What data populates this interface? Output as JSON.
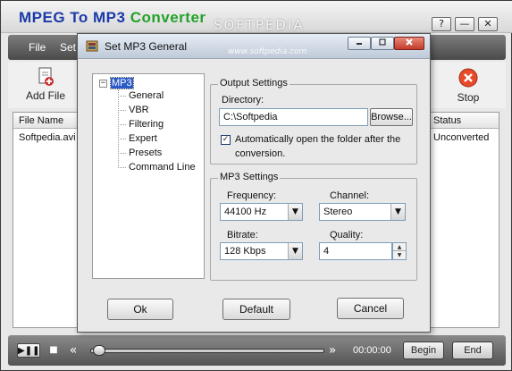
{
  "app": {
    "title_part1": "MPEG To MP3",
    "title_part2": "Converter",
    "watermark": "SOFTPEDIA",
    "help_glyph": "?",
    "minimize_glyph": "—",
    "close_glyph": "✕"
  },
  "menu": {
    "items": [
      "File",
      "Set"
    ]
  },
  "toolbar": {
    "add_file_label": "Add File",
    "stop_label": "Stop"
  },
  "file_list": {
    "columns": [
      "File Name",
      "Status"
    ],
    "rows": [
      {
        "file_name": "Softpedia.avi",
        "status": "Unconverted"
      }
    ]
  },
  "player": {
    "play_pause_glyph": "▶❚❚",
    "stop_glyph": "■",
    "rewind_glyph": "«",
    "forward_glyph": "»",
    "time": "00:00:00",
    "begin_label": "Begin",
    "end_label": "End",
    "seek_position": 0
  },
  "dialog": {
    "title": "Set MP3 General",
    "watermark": "www.softpedia.com",
    "tree": {
      "toggle": "−",
      "root": "MP3",
      "children": [
        "General",
        "VBR",
        "Filtering",
        "Expert",
        "Presets",
        "Command Line"
      ]
    },
    "output_settings": {
      "group_label": "Output Settings",
      "directory_label": "Directory:",
      "directory_value": "C:\\Softpedia",
      "browse_label": "Browse...",
      "auto_open_checked": true,
      "check_glyph": "✓",
      "auto_open_line1": "Automatically open the folder after the",
      "auto_open_line2": "conversion."
    },
    "mp3_settings": {
      "group_label": "MP3 Settings",
      "frequency_label": "Frequency:",
      "frequency_value": "44100 Hz",
      "channel_label": "Channel:",
      "channel_value": "Stereo",
      "bitrate_label": "Bitrate:",
      "bitrate_value": "128 Kbps",
      "quality_label": "Quality:",
      "quality_value": "4"
    },
    "buttons": {
      "ok": "Ok",
      "default": "Default",
      "cancel": "Cancel"
    }
  }
}
